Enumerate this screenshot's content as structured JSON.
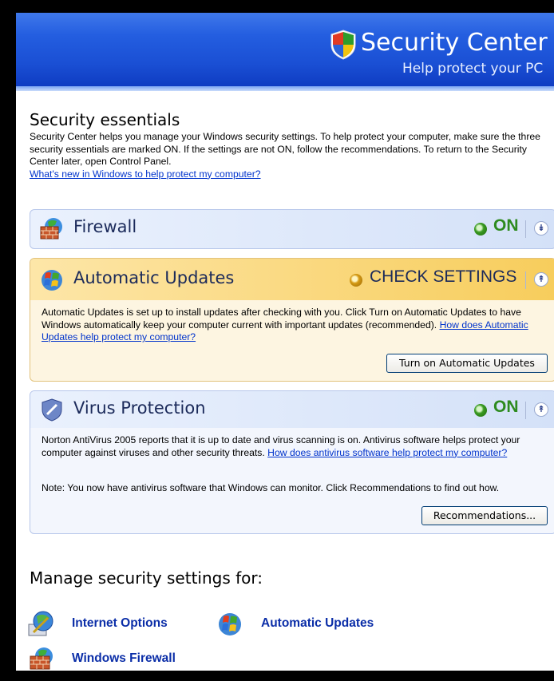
{
  "header": {
    "title": "Security Center",
    "subtitle": "Help protect your PC"
  },
  "essentials": {
    "title": "Security essentials",
    "intro": "Security Center helps you manage your Windows security settings. To help protect your computer, make sure the three security essentials are marked ON. If the settings are not ON, follow the recommendations. To return to the Security Center later, open Control Panel.",
    "whats_new_link": "What's new in Windows to help protect my computer?"
  },
  "panels": {
    "firewall": {
      "title": "Firewall",
      "status": "ON",
      "status_color": "#2e8b1f",
      "expanded": false
    },
    "updates": {
      "title": "Automatic Updates",
      "status": "CHECK SETTINGS",
      "status_color": "#1b2a5a",
      "body": "Automatic Updates is set up to install updates after checking with you. Click Turn on Automatic Updates to have Windows automatically keep your computer current with important updates (recommended).",
      "link": "How does Automatic Updates help protect my computer?",
      "button": "Turn on Automatic Updates",
      "expanded": true
    },
    "virus": {
      "title": "Virus Protection",
      "status": "ON",
      "status_color": "#2e8b1f",
      "body": "Norton AntiVirus 2005 reports that it is up to date and virus scanning is on. Antivirus software helps protect your computer against viruses and other security threats.",
      "link": "How does antivirus software help protect my computer?",
      "note": "Note: You now have antivirus software that Windows can monitor. Click Recommendations to find out how.",
      "button": "Recommendations...",
      "expanded": true
    }
  },
  "manage": {
    "title": "Manage security settings for:",
    "items": [
      {
        "label": "Internet Options",
        "icon": "internet-options-icon"
      },
      {
        "label": "Automatic Updates",
        "icon": "windows-logo-icon"
      },
      {
        "label": "Windows Firewall",
        "icon": "firewall-icon"
      }
    ]
  }
}
